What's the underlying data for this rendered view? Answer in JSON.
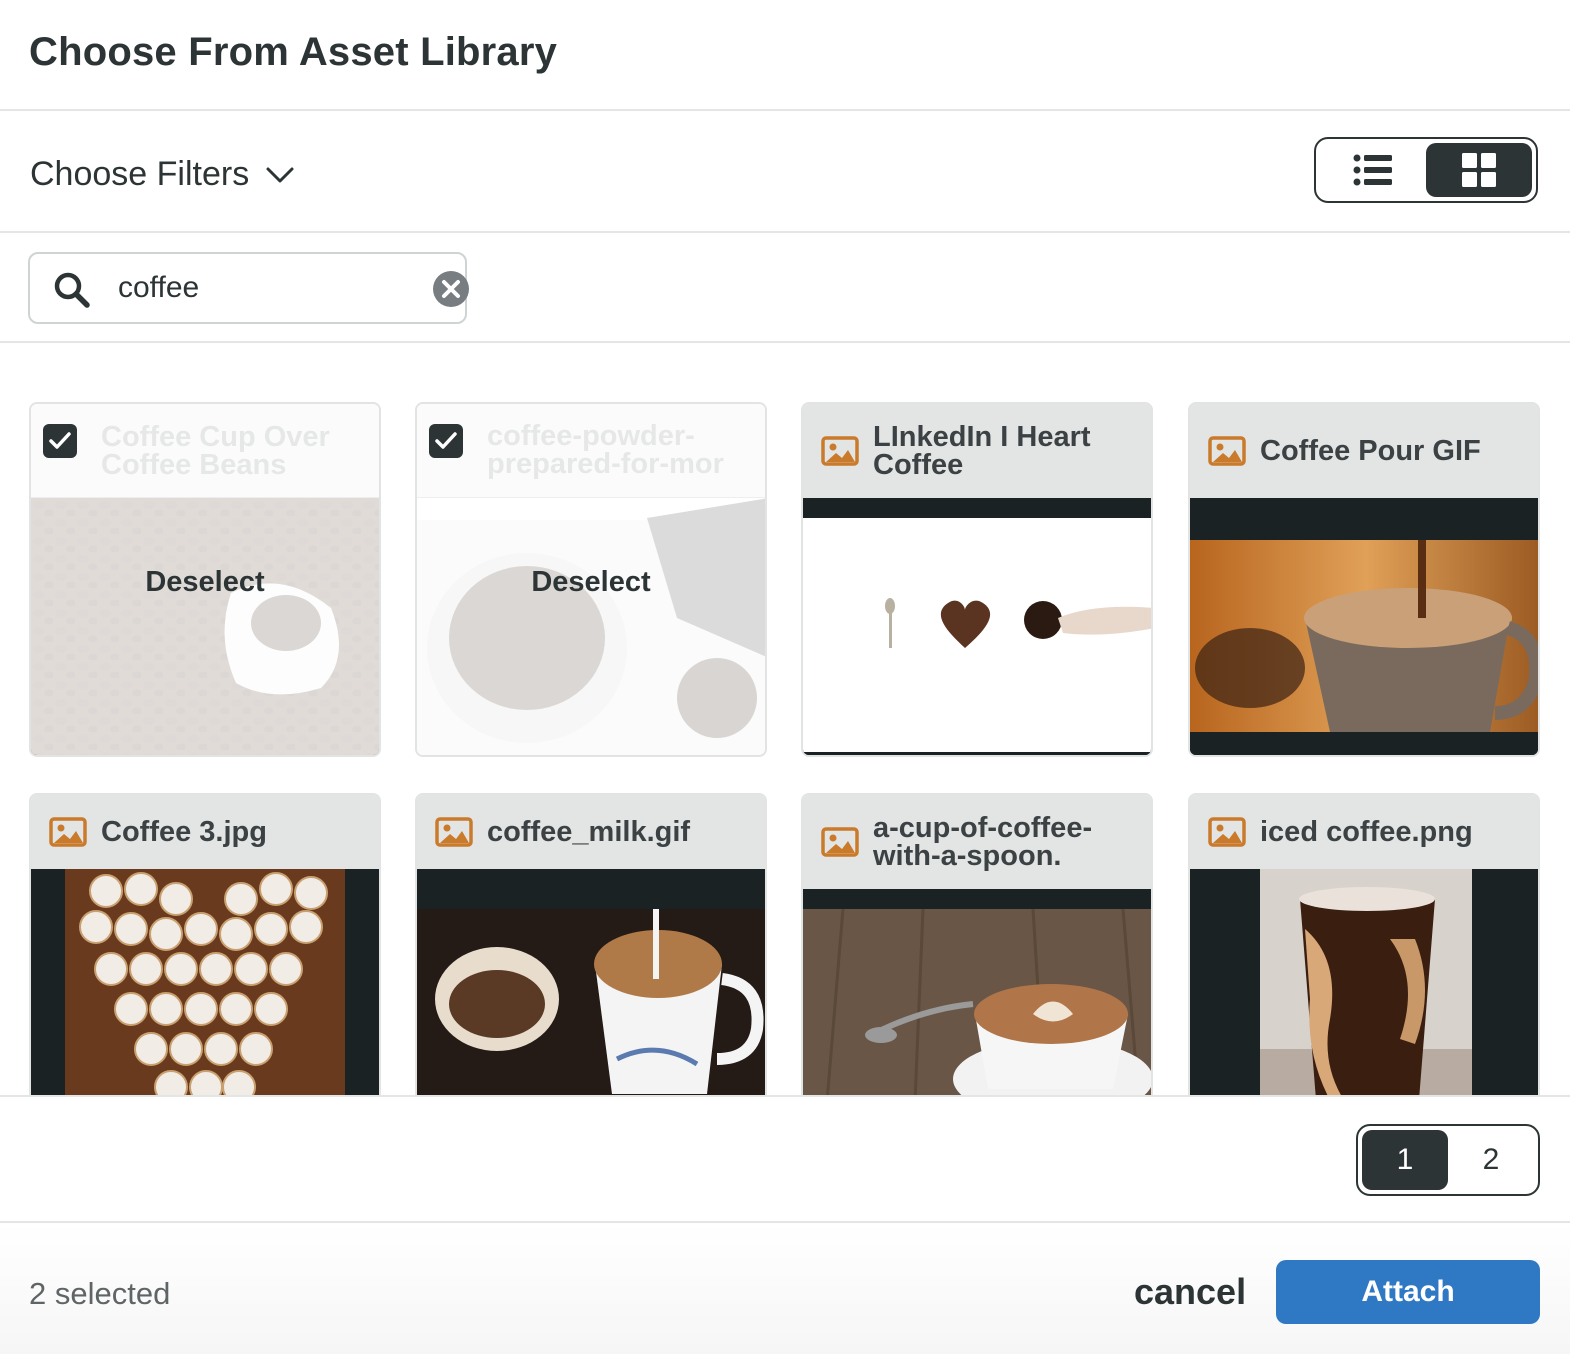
{
  "dialog": {
    "title": "Choose From Asset Library"
  },
  "filters": {
    "label": "Choose Filters",
    "icon": "chevron-down-icon"
  },
  "view_toggle": {
    "options": [
      "list",
      "grid"
    ],
    "active": "grid"
  },
  "search": {
    "value": "coffee",
    "placeholder": ""
  },
  "assets": [
    {
      "title": "Coffee Cup Over Coffee Beans",
      "selected": true,
      "action": "Deselect"
    },
    {
      "title": "coffee-powder-prepared-for-mor",
      "selected": true,
      "action": "Deselect"
    },
    {
      "title": "LInkedIn I Heart Coffee",
      "selected": false
    },
    {
      "title": "Coffee Pour GIF",
      "selected": false
    },
    {
      "title": "Coffee 3.jpg",
      "selected": false
    },
    {
      "title": "coffee_milk.gif",
      "selected": false
    },
    {
      "title": "a-cup-of-coffee-with-a-spoon.",
      "selected": false
    },
    {
      "title": "iced coffee.png",
      "selected": false
    }
  ],
  "pagination": {
    "pages": [
      "1",
      "2"
    ],
    "current": "1"
  },
  "footer": {
    "selected_count": "2 selected",
    "cancel_label": "cancel",
    "attach_label": "Attach"
  },
  "colors": {
    "primary": "#2f78c4",
    "dark": "#2d3436",
    "image_icon": "#c97a2a"
  }
}
